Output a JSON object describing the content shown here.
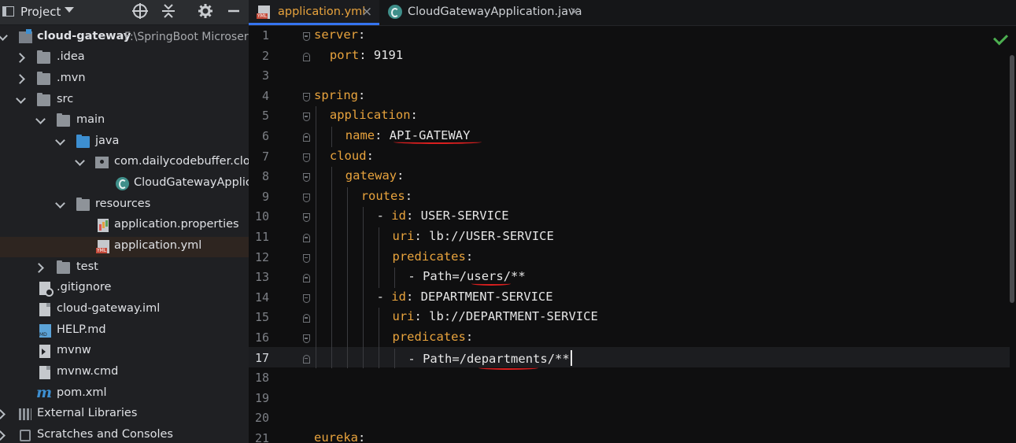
{
  "project_panel": {
    "title": "Project",
    "icons": [
      "target-icon",
      "collapse-all-icon",
      "gear-icon",
      "minimize-icon"
    ],
    "tree": [
      {
        "label": "cloud-gateway",
        "path": "F:\\SpringBoot Microserv",
        "icon": "module-folder-icon"
      },
      {
        "label": ".idea",
        "icon": "folder-icon"
      },
      {
        "label": ".mvn",
        "icon": "folder-icon"
      },
      {
        "label": "src",
        "icon": "folder-icon"
      },
      {
        "label": "main",
        "icon": "folder-icon"
      },
      {
        "label": "java",
        "icon": "source-folder-icon"
      },
      {
        "label": "com.dailycodebuffer.clouc",
        "icon": "package-icon"
      },
      {
        "label": "CloudGatewayApplica",
        "icon": "spring-class-icon"
      },
      {
        "label": "resources",
        "icon": "resources-folder-icon"
      },
      {
        "label": "application.properties",
        "icon": "properties-file-icon"
      },
      {
        "label": "application.yml",
        "icon": "yml-file-icon"
      },
      {
        "label": "test",
        "icon": "folder-icon"
      },
      {
        "label": ".gitignore",
        "icon": "gitignore-file-icon"
      },
      {
        "label": "cloud-gateway.iml",
        "icon": "iml-file-icon"
      },
      {
        "label": "HELP.md",
        "icon": "markdown-file-icon"
      },
      {
        "label": "mvnw",
        "icon": "script-file-icon"
      },
      {
        "label": "mvnw.cmd",
        "icon": "file-icon"
      },
      {
        "label": "pom.xml",
        "icon": "maven-icon"
      },
      {
        "label": "External Libraries",
        "icon": "libraries-icon"
      },
      {
        "label": "Scratches and Consoles",
        "icon": "scratches-icon"
      }
    ]
  },
  "editor": {
    "tabs": [
      {
        "label": "application.yml",
        "active": true
      },
      {
        "label": "CloudGatewayApplication.java",
        "active": false
      }
    ],
    "close_glyph": "×",
    "current_line": 17,
    "lines": [
      {
        "n": "1",
        "k": "server",
        "sep": ":",
        "v": ""
      },
      {
        "n": "2",
        "k": "port",
        "sep": ": ",
        "v": "9191"
      },
      {
        "n": "3",
        "k": "",
        "sep": "",
        "v": ""
      },
      {
        "n": "4",
        "k": "spring",
        "sep": ":",
        "v": ""
      },
      {
        "n": "5",
        "k": "application",
        "sep": ":",
        "v": ""
      },
      {
        "n": "6",
        "k": "name",
        "sep": ": ",
        "v": "API-GATEWAY"
      },
      {
        "n": "7",
        "k": "cloud",
        "sep": ":",
        "v": ""
      },
      {
        "n": "8",
        "k": "gateway",
        "sep": ":",
        "v": ""
      },
      {
        "n": "9",
        "k": "routes",
        "sep": ":",
        "v": ""
      },
      {
        "n": "10",
        "dash": "- ",
        "k": "id",
        "sep": ": ",
        "v": "USER-SERVICE"
      },
      {
        "n": "11",
        "k": "uri",
        "sep": ": ",
        "v": "lb://USER-SERVICE"
      },
      {
        "n": "12",
        "k": "predicates",
        "sep": ":",
        "v": ""
      },
      {
        "n": "13",
        "dash": "- ",
        "k": "",
        "sep": "",
        "v": "Path=/users/**"
      },
      {
        "n": "14",
        "dash": "- ",
        "k": "id",
        "sep": ": ",
        "v": "DEPARTMENT-SERVICE"
      },
      {
        "n": "15",
        "k": "uri",
        "sep": ": ",
        "v": "lb://DEPARTMENT-SERVICE"
      },
      {
        "n": "16",
        "k": "predicates",
        "sep": ":",
        "v": ""
      },
      {
        "n": "17",
        "dash": "- ",
        "k": "",
        "sep": "",
        "v": "Path=/departments/**"
      },
      {
        "n": "18",
        "k": "",
        "sep": "",
        "v": ""
      },
      {
        "n": "19",
        "k": "",
        "sep": "",
        "v": ""
      },
      {
        "n": "20",
        "k": "",
        "sep": "",
        "v": ""
      },
      {
        "n": "21",
        "k": "eureka",
        "sep": ":",
        "v": ""
      }
    ],
    "colors": {
      "key": "#e8a33d",
      "value": "#e6e6e6",
      "annotation": "#d91f1f",
      "tab_accent": "#3574f0"
    }
  }
}
